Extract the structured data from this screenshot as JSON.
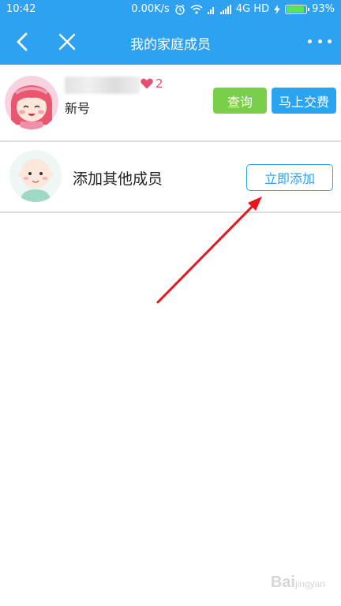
{
  "status_bar": {
    "time": "10:42",
    "network_speed": "0.00K/s",
    "network_type": "4G HD",
    "battery_percent": "93%",
    "battery_level": 0.93,
    "icons": [
      "alarm-icon",
      "wifi-icon",
      "signal-icon",
      "charging-icon",
      "battery-icon"
    ]
  },
  "nav": {
    "title": "我的家庭成员",
    "back_icon": "back-arrow-icon",
    "close_icon": "close-icon",
    "more_icon": "more-icon"
  },
  "member": {
    "avatar_icon": "girl-avatar-icon",
    "heart_count": "2",
    "name": "新号",
    "query_label": "查询",
    "pay_label": "马上交费"
  },
  "add_member": {
    "avatar_icon": "baby-avatar-icon",
    "label": "添加其他成员",
    "button_label": "立即添加"
  },
  "watermark": {
    "brand": "Bai",
    "sub": "jingyan"
  },
  "colors": {
    "primary": "#2ea2f1",
    "query_button": "#7bce4a",
    "pay_button": "#28a4f0",
    "heart": "#ea4d72",
    "arrow": "#e8151d"
  }
}
